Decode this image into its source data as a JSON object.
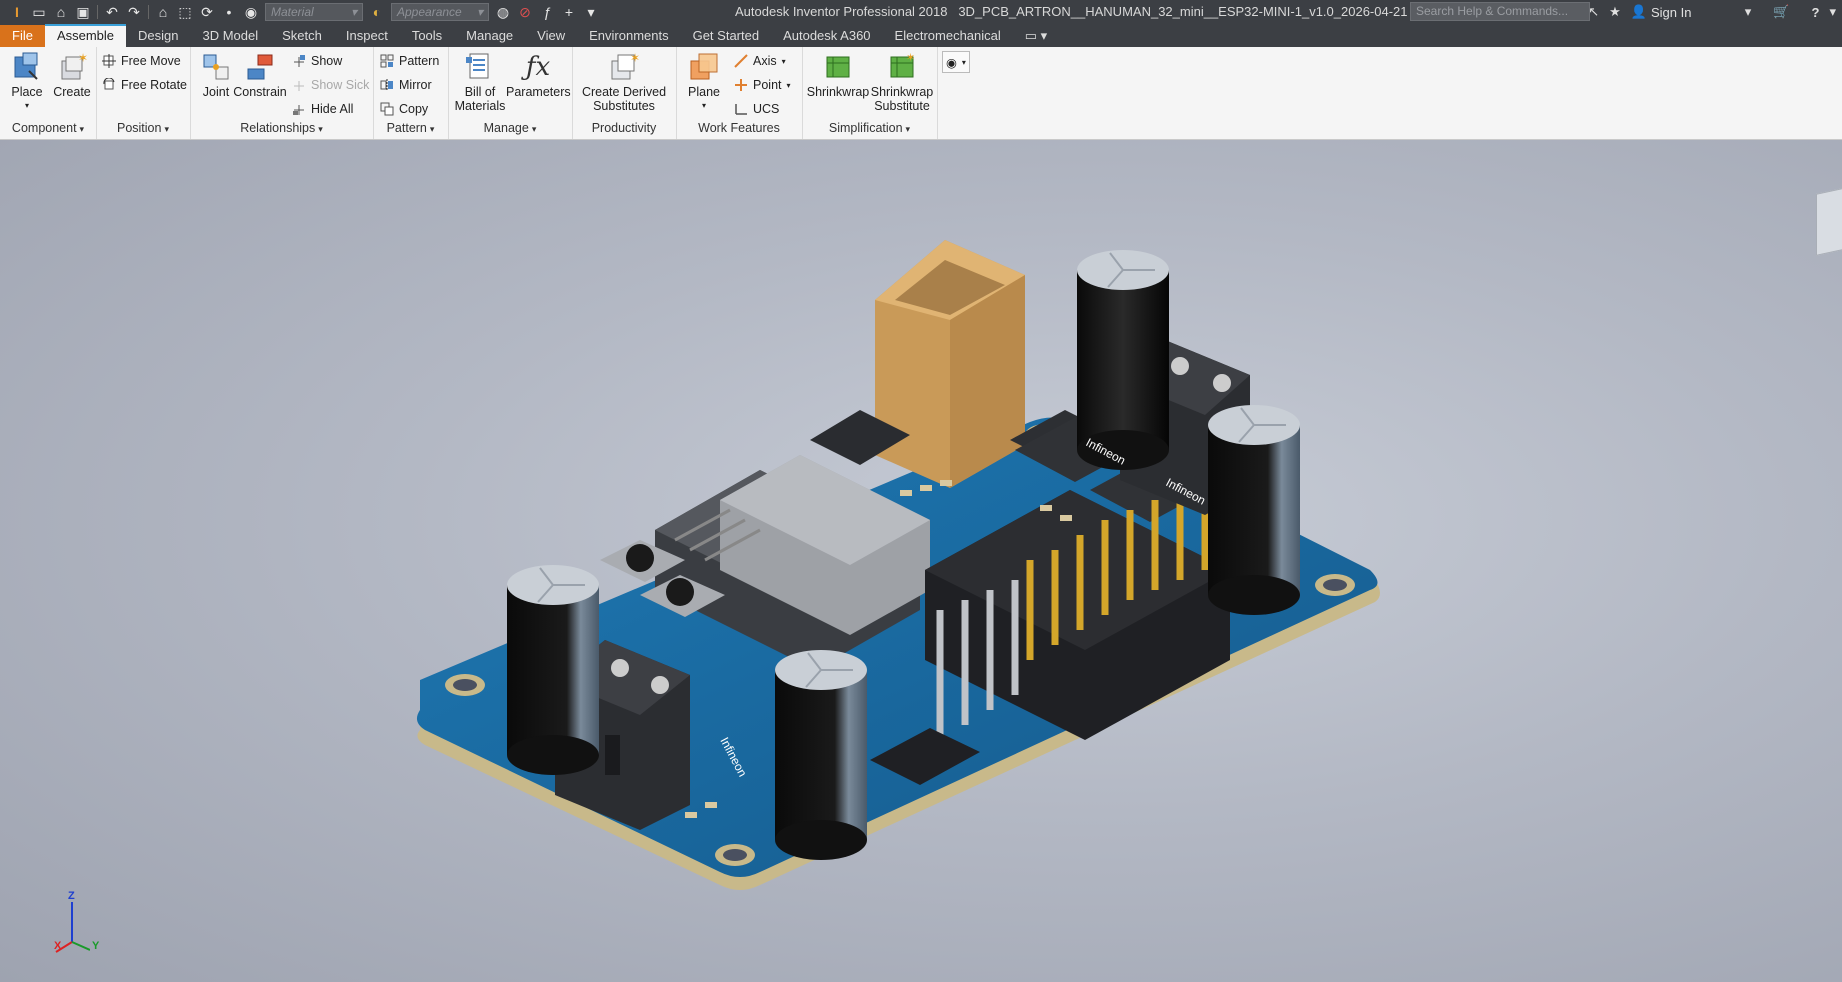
{
  "window": {
    "title": "Autodesk Inventor Professional 2018",
    "document": "3D_PCB_ARTRON__HANUMAN_32_mini__ESP32-MINI-1_v1.0_2026-04-21",
    "sign_in": "Sign In",
    "help": "?"
  },
  "quick_access": {
    "material_placeholder": "Material",
    "appearance_placeholder": "Appearance"
  },
  "search": {
    "placeholder": "Search Help & Commands..."
  },
  "tabs": [
    {
      "label": "File"
    },
    {
      "label": "Assemble"
    },
    {
      "label": "Design"
    },
    {
      "label": "3D Model"
    },
    {
      "label": "Sketch"
    },
    {
      "label": "Inspect"
    },
    {
      "label": "Tools"
    },
    {
      "label": "Manage"
    },
    {
      "label": "View"
    },
    {
      "label": "Environments"
    },
    {
      "label": "Get Started"
    },
    {
      "label": "Autodesk A360"
    },
    {
      "label": "Electromechanical"
    }
  ],
  "ribbon": {
    "component": {
      "label": "Component",
      "place": "Place",
      "create": "Create"
    },
    "position": {
      "label": "Position",
      "free_move": "Free Move",
      "free_rotate": "Free Rotate"
    },
    "relationships": {
      "label": "Relationships",
      "joint": "Joint",
      "constrain": "Constrain",
      "show": "Show",
      "show_sick": "Show Sick",
      "hide_all": "Hide All"
    },
    "pattern": {
      "label": "Pattern",
      "pattern": "Pattern",
      "mirror": "Mirror",
      "copy": "Copy"
    },
    "manage": {
      "label": "Manage",
      "bom_line1": "Bill of",
      "bom_line2": "Materials",
      "parameters": "Parameters"
    },
    "productivity": {
      "label": "Productivity",
      "line1": "Create Derived",
      "line2": "Substitutes"
    },
    "work_features": {
      "label": "Work Features",
      "plane": "Plane",
      "axis": "Axis",
      "point": "Point",
      "ucs": "UCS"
    },
    "simplification": {
      "label": "Simplification",
      "shrinkwrap": "Shrinkwrap",
      "sub_line1": "Shrinkwrap",
      "sub_line2": "Substitute"
    }
  },
  "viewport": {
    "triad": {
      "z": "Z",
      "x": "X",
      "y": "Y"
    },
    "silkscreen": {
      "infineon": "Infineon"
    }
  },
  "colors": {
    "title_bar": "#3c3f44",
    "file_tab": "#d9721b",
    "pcb_blue": "#1c6ea4",
    "pcb_edge": "#c8b98a"
  }
}
